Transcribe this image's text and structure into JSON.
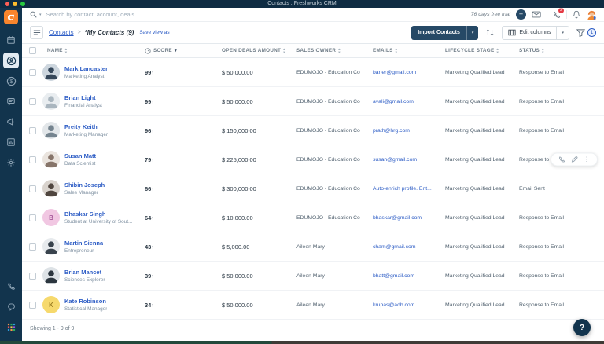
{
  "window": {
    "title": "Contacts : Freshworks CRM"
  },
  "colors": {
    "navy": "#12344d",
    "accent_blue": "#2c5cc5",
    "logo_orange": "#f8852d",
    "badge_red": "#e43a45"
  },
  "topnav": {
    "search_placeholder": "Search by contact, account, deals",
    "trial_label": "76 days free trial",
    "notification_count": "2",
    "icons": [
      "search-icon",
      "plus-icon",
      "envelope-icon",
      "phone-icon",
      "bell-icon",
      "user-avatar"
    ]
  },
  "sidebar": {
    "items": [
      "calendar",
      "contacts",
      "deals",
      "conversations",
      "campaigns",
      "analytics",
      "settings"
    ],
    "active_item": "contacts",
    "bottom_items": [
      "phone",
      "chat",
      "apps-grid"
    ]
  },
  "toolbar": {
    "breadcrumb_parent": "Contacts",
    "breadcrumb_sep": ">",
    "breadcrumb_current": "*My Contacts (9)",
    "save_view_label": "Save view as",
    "import_label": "Import Contacts",
    "edit_columns_label": "Edit columns",
    "filter_count": "1"
  },
  "table": {
    "headers": {
      "name": "NAME",
      "score": "SCORE",
      "deal": "OPEN DEALS AMOUNT",
      "owner": "SALES OWNER",
      "email": "EMAILS",
      "stage": "LIFECYCLE STAGE",
      "status": "STATUS"
    },
    "rows": [
      {
        "name": "Mark Lancaster",
        "title": "Marketing Analyst",
        "score": "99",
        "deal": "$ 50,000.00",
        "owner": "EDUMOJO - Education Co",
        "email": "baner@gmail.com",
        "stage": "Marketing Qualified Lead",
        "status": "Response to Email",
        "avatar": {
          "kind": "photo",
          "bg": "#cdd6de",
          "fg": "#35475a"
        }
      },
      {
        "name": "Brian Light",
        "title": "Financial Analyst",
        "score": "99",
        "deal": "$ 50,000.00",
        "owner": "EDUMOJO - Education Co",
        "email": "avali@gmail.com",
        "stage": "Marketing Qualified Lead",
        "status": "Response to Email",
        "avatar": {
          "kind": "photo",
          "bg": "#e9edf0",
          "fg": "#aab6bf"
        }
      },
      {
        "name": "Preity Keith",
        "title": "Marketing Manager",
        "score": "96",
        "deal": "$ 150,000.00",
        "owner": "EDUMOJO - Education Co",
        "email": "prath@hrg.com",
        "stage": "Marketing Qualified Lead",
        "status": "Response to Email",
        "avatar": {
          "kind": "photo",
          "bg": "#e2e6e9",
          "fg": "#75848f"
        }
      },
      {
        "name": "Susan Matt",
        "title": "Data Scientist",
        "score": "79",
        "deal": "$ 225,000.00",
        "owner": "EDUMOJO - Education Co",
        "email": "susan@gmail.com",
        "stage": "Marketing Qualified Lead",
        "status": "Response to Email",
        "avatar": {
          "kind": "photo",
          "bg": "#eae4de",
          "fg": "#87756a"
        },
        "hover_actions": true
      },
      {
        "name": "Shibin Joseph",
        "title": "Sales Manager",
        "score": "66",
        "deal": "$ 300,000.00",
        "owner": "EDUMOJO - Education Co",
        "email": "Auto-enrich profile. Ent...",
        "stage": "Marketing Qualified Lead",
        "status": "Email Sent",
        "avatar": {
          "kind": "photo",
          "bg": "#d9d3cd",
          "fg": "#50463f"
        }
      },
      {
        "name": "Bhaskar Singh",
        "title": "Student at University of Sout...",
        "score": "64",
        "deal": "$ 10,000.00",
        "owner": "EDUMOJO - Education Co",
        "email": "bhaskar@gmail.com",
        "stage": "Marketing Qualified Lead",
        "status": "Response to Email",
        "avatar": {
          "kind": "initial",
          "letter": "B",
          "bg": "#f1c7e2",
          "fg": "#a85a9c"
        }
      },
      {
        "name": "Martin Sienna",
        "title": "Entrepreneur",
        "score": "43",
        "deal": "$ 5,000.00",
        "owner": "Aileen Mary",
        "email": "cham@gmail.com",
        "stage": "Marketing Qualified Lead",
        "status": "Response to Email",
        "avatar": {
          "kind": "photo",
          "bg": "#e7eaed",
          "fg": "#39434d"
        }
      },
      {
        "name": "Brian Mancet",
        "title": "Sciences Explorer",
        "score": "39",
        "deal": "$ 50,000.00",
        "owner": "Aileen Mary",
        "email": "bhatt@gmail.com",
        "stage": "Marketing Qualified Lead",
        "status": "Response to Email",
        "avatar": {
          "kind": "photo",
          "bg": "#dde2e6",
          "fg": "#2c363f"
        }
      },
      {
        "name": "Kate Robinson",
        "title": "Statistical Manager",
        "score": "34",
        "deal": "$ 50,000.00",
        "owner": "Aileen Mary",
        "email": "krupas@adb.com",
        "stage": "Marketing Qualified Lead",
        "status": "Response to Email",
        "avatar": {
          "kind": "initial",
          "letter": "K",
          "bg": "#f6d96d",
          "fg": "#9b7d22"
        }
      }
    ]
  },
  "footer": {
    "showing_label": "Showing 1 - 9 of 9"
  },
  "help_button": {
    "label": "?"
  }
}
